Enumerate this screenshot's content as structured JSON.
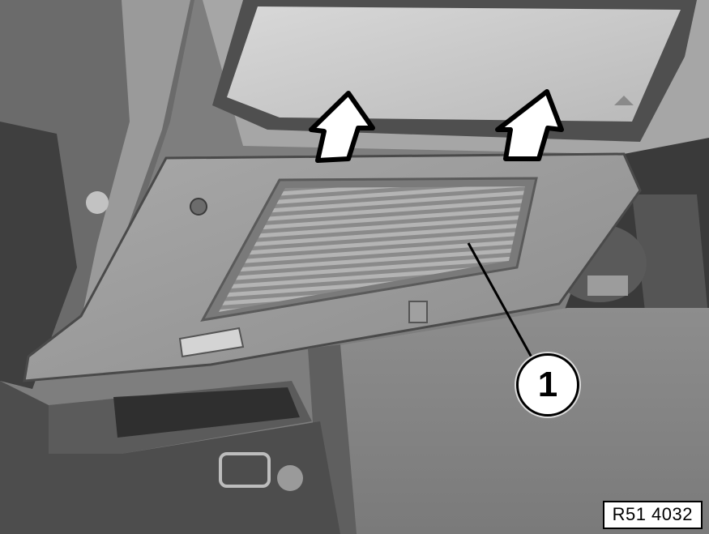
{
  "callouts": [
    {
      "number": "1"
    }
  ],
  "figure_reference": "R51 4032",
  "colors": {
    "background": "#8f8f8f",
    "callout_fill": "#ffffff",
    "ink": "#000000"
  }
}
